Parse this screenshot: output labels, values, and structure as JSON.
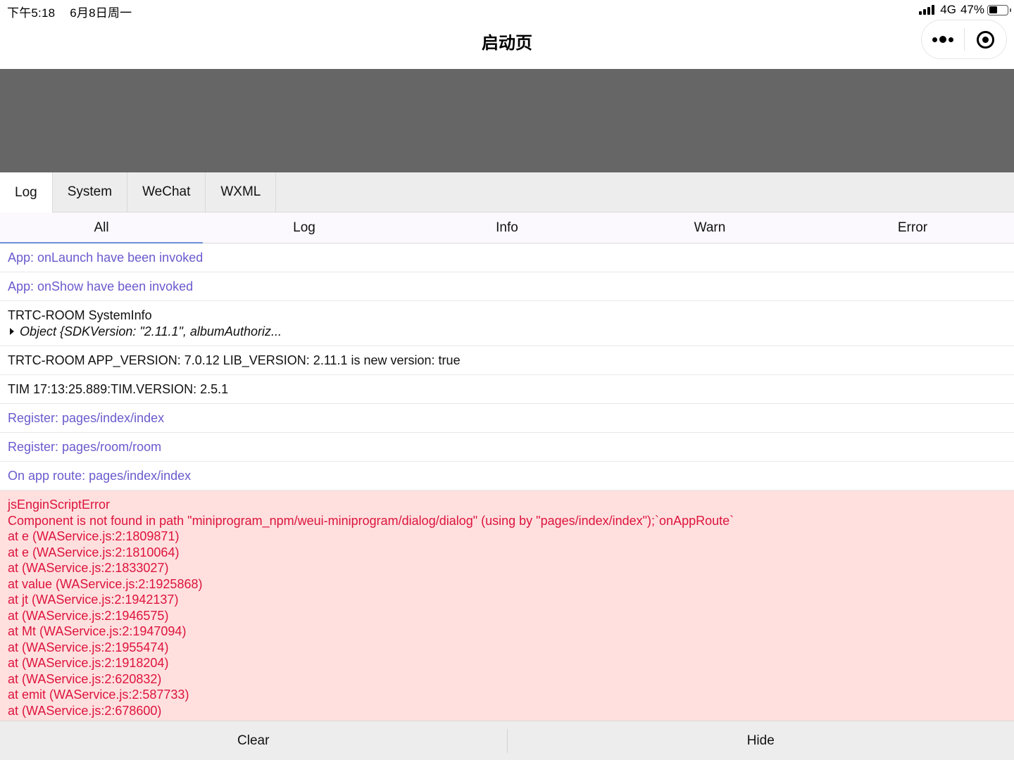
{
  "status_bar": {
    "time": "下午5:18",
    "date": "6月8日周一",
    "network": "4G",
    "battery_percent": "47%",
    "battery_level": 0.47
  },
  "nav": {
    "title": "启动页",
    "more_icon": "more-dots-icon",
    "close_icon": "record-circle-icon"
  },
  "console": {
    "tabs": [
      "Log",
      "System",
      "WeChat",
      "WXML"
    ],
    "active_tab": "Log",
    "filters": [
      "All",
      "Log",
      "Info",
      "Warn",
      "Error"
    ],
    "active_filter": "All",
    "logs": [
      {
        "type": "info",
        "text": "App: onLaunch have been invoked"
      },
      {
        "type": "info",
        "text": "App: onShow have been invoked"
      },
      {
        "type": "log",
        "text": "TRTC-ROOM SystemInfo",
        "object_preview": "Object {SDKVersion: \"2.11.1\", albumAuthoriz..."
      },
      {
        "type": "log",
        "text": "TRTC-ROOM APP_VERSION: 7.0.12 LIB_VERSION: 2.11.1 is new version: true"
      },
      {
        "type": "log",
        "text": "TIM 17:13:25.889:TIM.VERSION: 2.5.1"
      },
      {
        "type": "info",
        "text": "Register: pages/index/index"
      },
      {
        "type": "info",
        "text": "Register: pages/room/room"
      },
      {
        "type": "info",
        "text": "On app route: pages/index/index"
      }
    ],
    "error": {
      "lines": [
        "jsEnginScriptError",
        "Component is not found in path \"miniprogram_npm/weui-miniprogram/dialog/dialog\" (using by \"pages/index/index\");`onAppRoute`",
        "at e (WAService.js:2:1809871)",
        "at e (WAService.js:2:1810064)",
        "at (WAService.js:2:1833027)",
        "at value (WAService.js:2:1925868)",
        "at jt (WAService.js:2:1942137)",
        "at (WAService.js:2:1946575)",
        "at Mt (WAService.js:2:1947094)",
        "at (WAService.js:2:1955474)",
        "at (WAService.js:2:1918204)",
        "at (WAService.js:2:620832)",
        "at emit (WAService.js:2:587733)",
        "at (WAService.js:2:678600)"
      ]
    },
    "toolbar": {
      "clear_label": "Clear",
      "hide_label": "Hide"
    }
  },
  "colors": {
    "page_background": "#666666",
    "info_text": "#6a5acd",
    "error_text": "#dc143c",
    "error_background": "#ffe0df",
    "active_filter_underline": "#6d8fd8"
  }
}
